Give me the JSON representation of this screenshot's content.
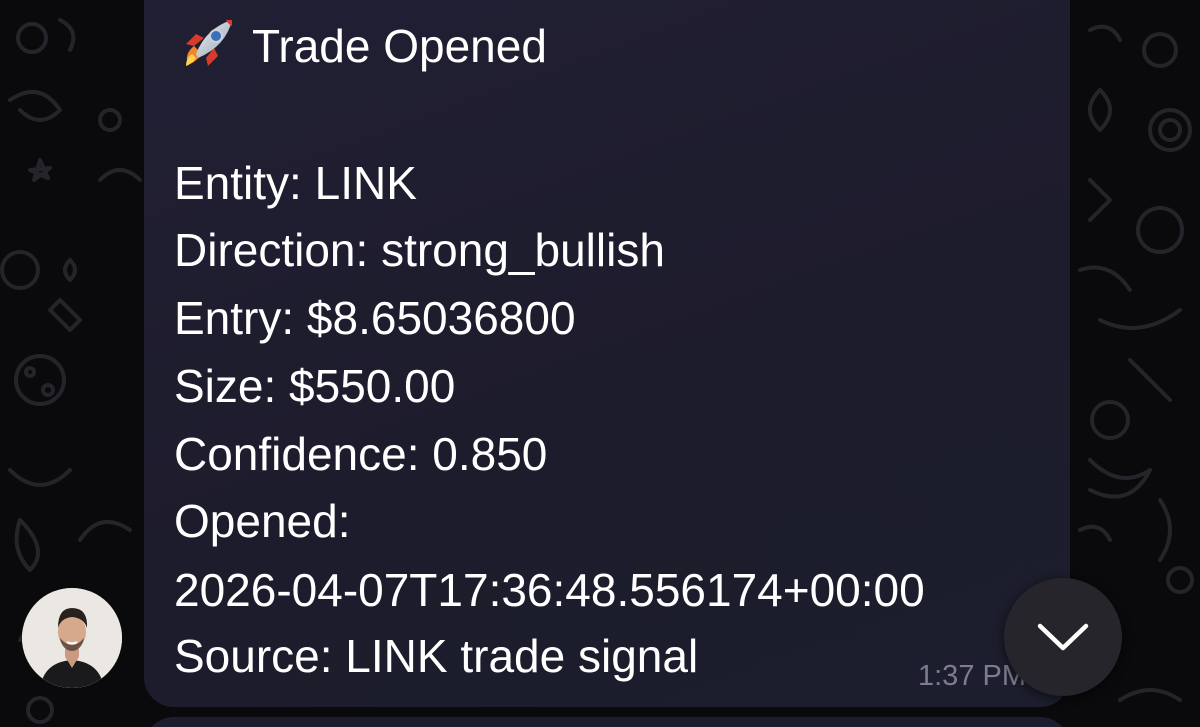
{
  "message": {
    "title": "Trade Opened",
    "title_icon": "rocket-emoji",
    "lines": [
      "Entity: LINK",
      "Direction: strong_bullish",
      "Entry: $8.65036800",
      "Size: $550.00",
      "Confidence: 0.850",
      "Opened:",
      "2026-04-07T17:36:48.556174+00:00",
      "Source: LINK trade signal"
    ],
    "time": "1:37 PM"
  },
  "colors": {
    "chat_background": "#0a0a0c",
    "bubble": "#1f1e2f",
    "text": "#ffffff",
    "time": "#7d7b8f",
    "scroll_button": "#25252b"
  },
  "icons": {
    "scroll": "chevron-down-icon",
    "avatar": "sender-avatar"
  }
}
